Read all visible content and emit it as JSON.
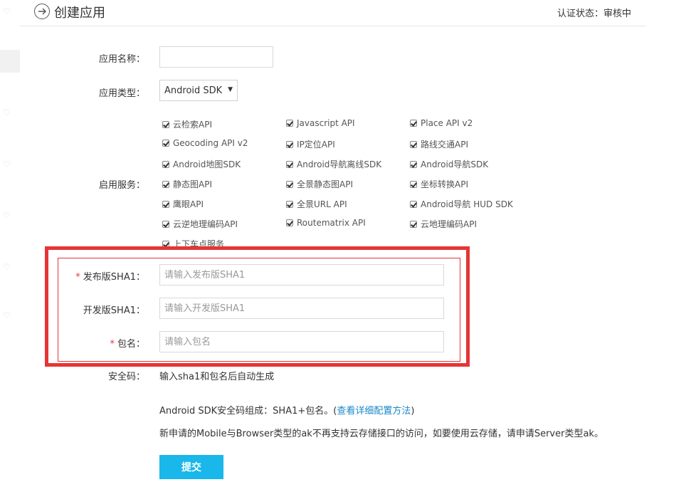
{
  "header": {
    "title": "创建应用",
    "status_label": "认证状态：",
    "status_value": "审核中"
  },
  "form": {
    "app_name_label": "应用名称：",
    "app_name_value": "",
    "app_type_label": "应用类型：",
    "app_type_value": "Android SDK",
    "services_label": "启用服务：",
    "services": [
      {
        "label": "云检索API",
        "checked": true
      },
      {
        "label": "Javascript API",
        "checked": true
      },
      {
        "label": "Place API v2",
        "checked": true
      },
      {
        "label": "Geocoding API v2",
        "checked": true
      },
      {
        "label": "IP定位API",
        "checked": true
      },
      {
        "label": "路线交通API",
        "checked": true
      },
      {
        "label": "Android地图SDK",
        "checked": true
      },
      {
        "label": "Android导航离线SDK",
        "checked": true
      },
      {
        "label": "Android导航SDK",
        "checked": true
      },
      {
        "label": "静态图API",
        "checked": true
      },
      {
        "label": "全景静态图API",
        "checked": true
      },
      {
        "label": "坐标转换API",
        "checked": true
      },
      {
        "label": "鹰眼API",
        "checked": true
      },
      {
        "label": "全景URL API",
        "checked": true
      },
      {
        "label": "Android导航 HUD SDK",
        "checked": true
      },
      {
        "label": "云逆地理编码API",
        "checked": true
      },
      {
        "label": "Routematrix API",
        "checked": true
      },
      {
        "label": "云地理编码API",
        "checked": true
      },
      {
        "label": "上下车点服务",
        "checked": true
      }
    ],
    "required_mark": "*",
    "release_sha1_label": "发布版SHA1：",
    "release_sha1_placeholder": "请输入发布版SHA1",
    "dev_sha1_label": "开发版SHA1：",
    "dev_sha1_placeholder": "请输入开发版SHA1",
    "package_label": "包名：",
    "package_placeholder": "请输入包名",
    "security_code_label": "安全码：",
    "security_code_value": "输入sha1和包名后自动生成",
    "note_prefix": "Android SDK安全码组成：SHA1+包名。(",
    "note_link": "查看详细配置方法",
    "note_suffix": ")",
    "notice": "新申请的Mobile与Browser类型的ak不再支持云存储接口的访问，如要使用云存储，请申请Server类型ak。",
    "submit_label": "提交"
  },
  "colors": {
    "accent": "#19b7ea",
    "highlight": "#e53535",
    "required": "#e4393c",
    "link": "#1a87c9"
  }
}
